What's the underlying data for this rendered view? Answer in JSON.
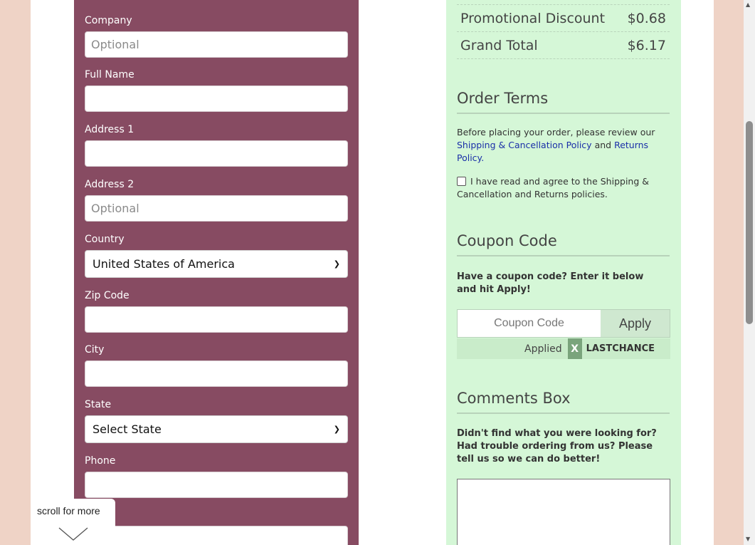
{
  "form": {
    "company": {
      "label": "Company",
      "placeholder": "Optional"
    },
    "full_name": {
      "label": "Full Name",
      "placeholder": ""
    },
    "address1": {
      "label": "Address 1",
      "placeholder": ""
    },
    "address2": {
      "label": "Address 2",
      "placeholder": "Optional"
    },
    "country": {
      "label": "Country",
      "value": "United States of America"
    },
    "zip": {
      "label": "Zip Code",
      "placeholder": ""
    },
    "city": {
      "label": "City",
      "placeholder": ""
    },
    "state": {
      "label": "State",
      "value": "Select State"
    },
    "phone": {
      "label": "Phone",
      "placeholder": ""
    }
  },
  "summary": {
    "discount_label": "Promotional Discount",
    "discount_value": "$0.68",
    "total_label": "Grand Total",
    "total_value": "$6.17"
  },
  "order_terms": {
    "title": "Order Terms",
    "intro": "Before placing your order, please review our",
    "link1": "Shipping & Cancellation Policy",
    "and": "and",
    "link2": "Returns Policy",
    "agree": "I have read and agree to the Shipping & Cancellation and Returns policies."
  },
  "coupon": {
    "title": "Coupon Code",
    "prompt": "Have a coupon code? Enter it below and hit Apply!",
    "placeholder": "Coupon Code",
    "apply": "Apply",
    "applied_label": "Applied",
    "remove": "X",
    "code": "LASTCHANCE"
  },
  "comments": {
    "title": "Comments Box",
    "prompt": "Didn't find what you were looking for? Had trouble ordering from us? Please tell us so we can do better!"
  },
  "scroll_hint": "scroll for more",
  "icons": {
    "chevron": "chevron-down-icon",
    "checkbox": "checkbox-icon"
  }
}
